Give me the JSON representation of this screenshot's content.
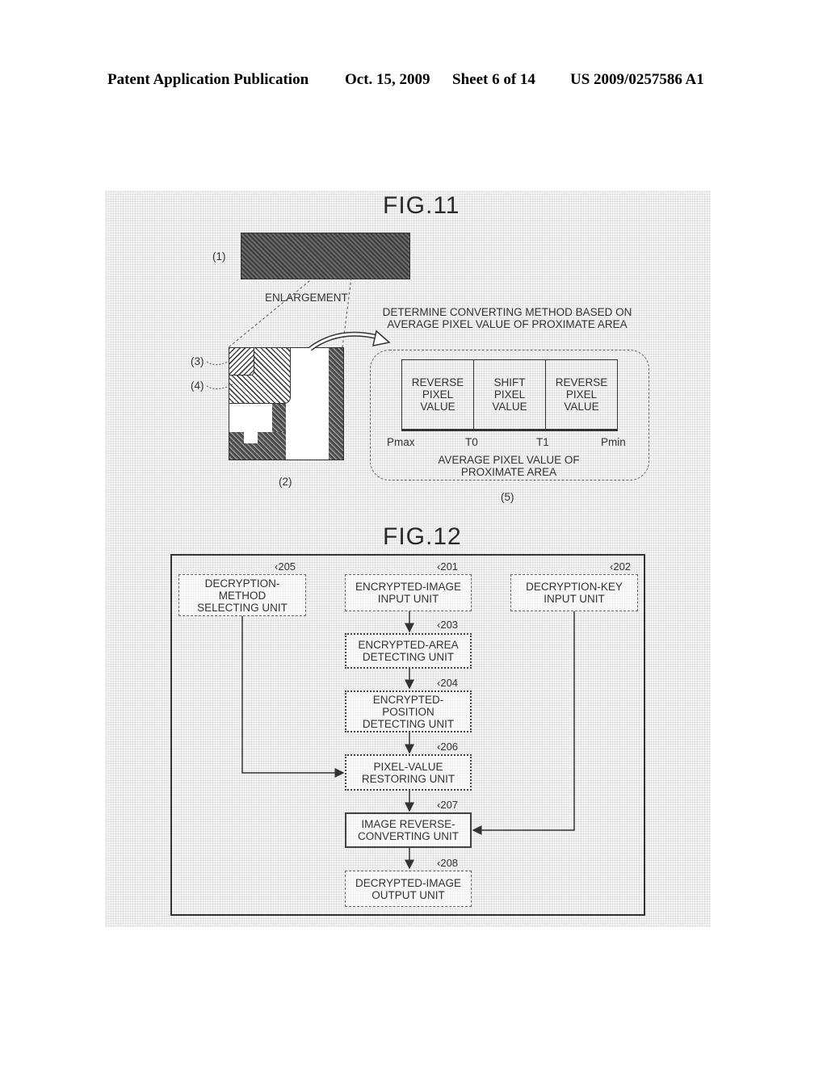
{
  "header": {
    "publication": "Patent Application Publication",
    "date": "Oct. 15, 2009",
    "sheet": "Sheet 6 of 14",
    "number": "US 2009/0257586 A1"
  },
  "fig11": {
    "title": "FIG.11",
    "label_1": "(1)",
    "label_2": "(2)",
    "label_3": "(3)",
    "label_4": "(4)",
    "label_5": "(5)",
    "enlargement": "ENLARGEMENT",
    "determine_line1": "DETERMINE CONVERTING METHOD BASED ON",
    "determine_line2": "AVERAGE PIXEL VALUE OF PROXIMATE AREA",
    "segments": [
      {
        "line1": "REVERSE",
        "line2": "PIXEL",
        "line3": "VALUE"
      },
      {
        "line1": "SHIFT",
        "line2": "PIXEL",
        "line3": "VALUE"
      },
      {
        "line1": "REVERSE",
        "line2": "PIXEL",
        "line3": "VALUE"
      }
    ],
    "axis_ticks": [
      "Pmax",
      "T0",
      "T1",
      "Pmin"
    ],
    "axis_label_line1": "AVERAGE PIXEL VALUE OF",
    "axis_label_line2": "PROXIMATE AREA"
  },
  "fig12": {
    "title": "FIG.12",
    "units": {
      "u205": {
        "ref": "205",
        "line1": "DECRYPTION-",
        "line2": "METHOD",
        "line3": "SELECTING UNIT"
      },
      "u201": {
        "ref": "201",
        "line1": "ENCRYPTED-IMAGE",
        "line2": "INPUT UNIT"
      },
      "u202": {
        "ref": "202",
        "line1": "DECRYPTION-KEY",
        "line2": "INPUT UNIT"
      },
      "u203": {
        "ref": "203",
        "line1": "ENCRYPTED-AREA",
        "line2": "DETECTING UNIT"
      },
      "u204": {
        "ref": "204",
        "line1": "ENCRYPTED-",
        "line2": "POSITION",
        "line3": "DETECTING UNIT"
      },
      "u206": {
        "ref": "206",
        "line1": "PIXEL-VALUE",
        "line2": "RESTORING UNIT"
      },
      "u207": {
        "ref": "207",
        "line1": "IMAGE REVERSE-",
        "line2": "CONVERTING UNIT"
      },
      "u208": {
        "ref": "208",
        "line1": "DECRYPTED-IMAGE",
        "line2": "OUTPUT UNIT"
      }
    }
  }
}
